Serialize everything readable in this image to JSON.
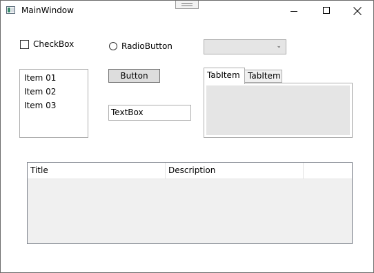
{
  "window": {
    "title": "MainWindow"
  },
  "checkbox": {
    "label": "CheckBox",
    "checked": false
  },
  "radio": {
    "label": "RadioButton",
    "checked": false
  },
  "combobox": {
    "selected": ""
  },
  "listbox": {
    "items": [
      "Item 01",
      "Item 02",
      "Item 03"
    ]
  },
  "button": {
    "label": "Button"
  },
  "textbox": {
    "value": "TextBox"
  },
  "tabs": [
    {
      "label": "TabItem",
      "selected": true
    },
    {
      "label": "TabItem",
      "selected": false
    }
  ],
  "datagrid": {
    "columns": [
      "Title",
      "Description",
      ""
    ],
    "rows": []
  }
}
